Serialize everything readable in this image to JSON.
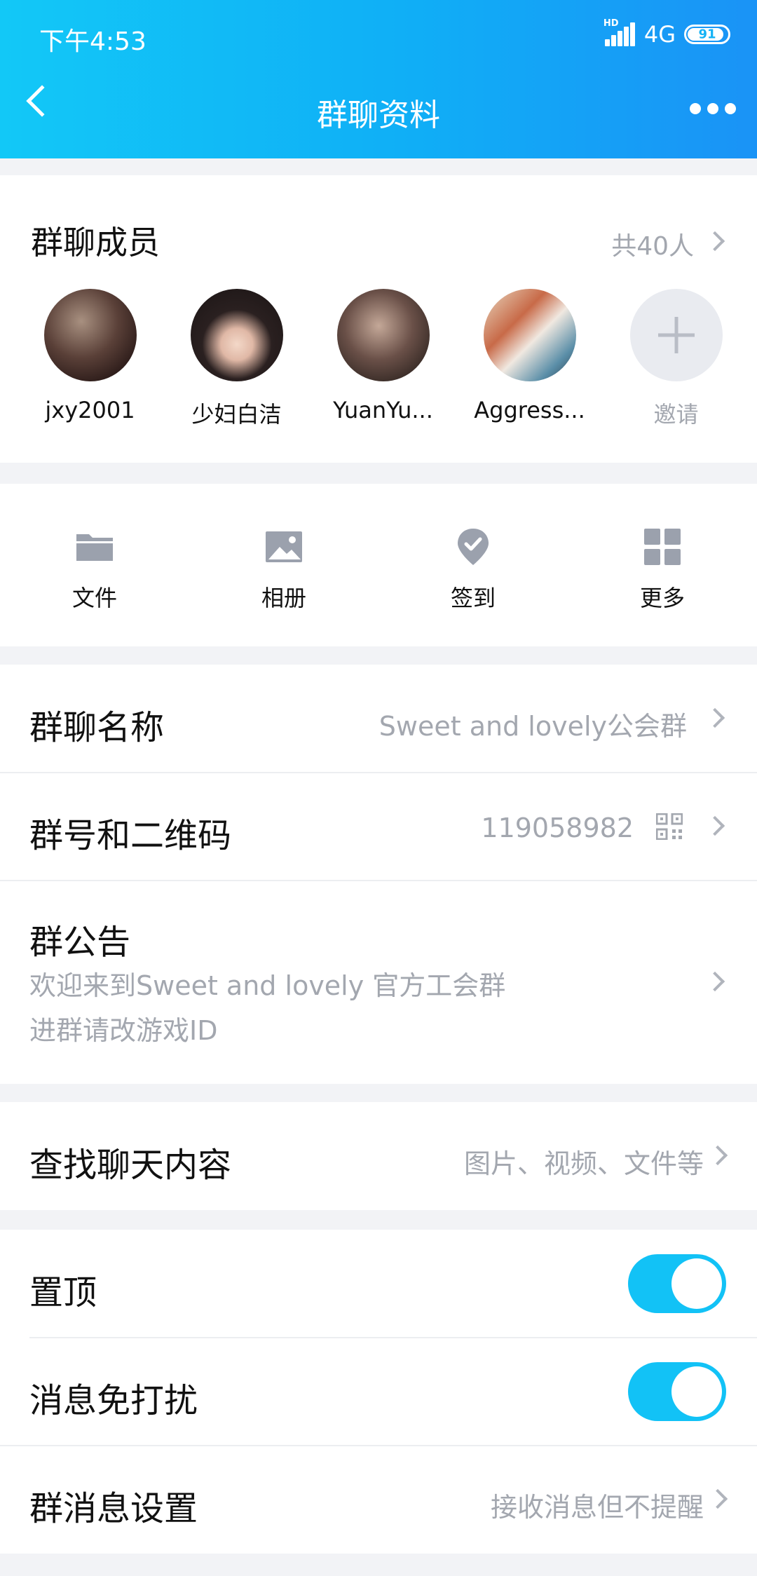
{
  "status_bar": {
    "time": "下午4:53",
    "network": "4G",
    "hd": "HD",
    "battery": "91"
  },
  "header": {
    "title": "群聊资料"
  },
  "members_section": {
    "title": "群聊成员",
    "count": "共40人",
    "members": [
      {
        "name": "jxy2001"
      },
      {
        "name": "少妇白洁"
      },
      {
        "name": "YuanYu..."
      },
      {
        "name": "Aggress..."
      }
    ],
    "invite_label": "邀请"
  },
  "tools": [
    {
      "label": "文件",
      "icon": "folder-icon"
    },
    {
      "label": "相册",
      "icon": "image-icon"
    },
    {
      "label": "签到",
      "icon": "location-pin-icon"
    },
    {
      "label": "更多",
      "icon": "grid-icon"
    }
  ],
  "group_name": {
    "label": "群聊名称",
    "value": "Sweet and lovely公会群"
  },
  "group_number": {
    "label": "群号和二维码",
    "value": "119058982"
  },
  "announcement": {
    "label": "群公告",
    "line1": "欢迎来到Sweet and lovely 官方工会群",
    "line2": "进群请改游戏ID"
  },
  "search_chat": {
    "label": "查找聊天内容",
    "value": "图片、视频、文件等"
  },
  "pin_top": {
    "label": "置顶",
    "on": true
  },
  "do_not_disturb": {
    "label": "消息免打扰",
    "on": true
  },
  "message_settings": {
    "label": "群消息设置",
    "value": "接收消息但不提醒"
  },
  "colors": {
    "accent": "#12c2f6",
    "header_start": "#12c8f7",
    "header_end": "#1a93f6",
    "secondary_text": "#a3a7af"
  }
}
